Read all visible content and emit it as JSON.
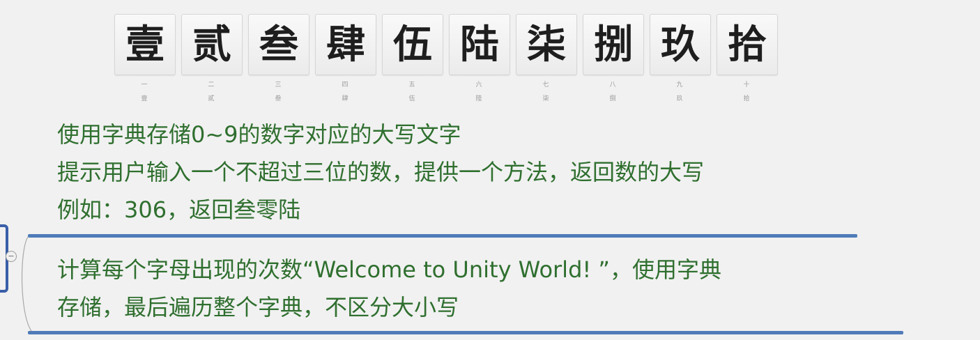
{
  "tiles": [
    {
      "char": "壹",
      "sub1": "一",
      "sub2": "壹"
    },
    {
      "char": "贰",
      "sub1": "二",
      "sub2": "貳"
    },
    {
      "char": "叁",
      "sub1": "三",
      "sub2": "叁"
    },
    {
      "char": "肆",
      "sub1": "四",
      "sub2": "肆"
    },
    {
      "char": "伍",
      "sub1": "五",
      "sub2": "伍"
    },
    {
      "char": "陆",
      "sub1": "六",
      "sub2": "陸"
    },
    {
      "char": "柒",
      "sub1": "七",
      "sub2": "柒"
    },
    {
      "char": "捌",
      "sub1": "八",
      "sub2": "捌"
    },
    {
      "char": "玖",
      "sub1": "九",
      "sub2": "玖"
    },
    {
      "char": "拾",
      "sub1": "十",
      "sub2": "拾"
    }
  ],
  "task1": {
    "line1": "使用字典存储0~9的数字对应的大写文字",
    "line2": "提示用户输入一个不超过三位的数，提供一个方法，返回数的大写",
    "line3": "例如：306，返回叁零陆"
  },
  "task2": {
    "line1": "计算每个字母出现的次数“Welcome to Unity World! ”，使用字典",
    "line2": "存储，最后遍历整个字典，不区分大小写"
  },
  "outline": {
    "collapse_symbol": "−"
  },
  "colors": {
    "task_text": "#2f6f2f",
    "separator": "#4f7bb8",
    "bracket": "#3a5fa8"
  }
}
